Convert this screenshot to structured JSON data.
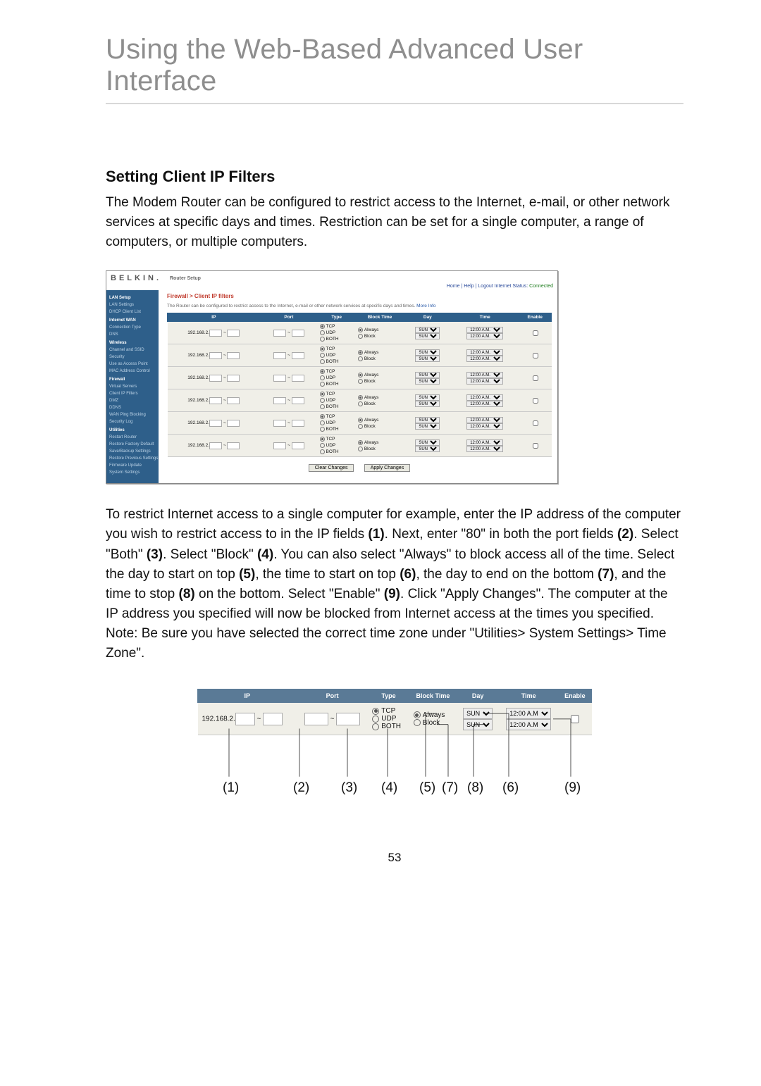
{
  "page_title": "Using the Web-Based Advanced User Interface",
  "section_title": "Setting Client IP Filters",
  "intro_paragraph": "The Modem Router can be configured to restrict access to the Internet, e-mail, or other network services at specific days and times. Restriction can be set for a single computer, a range of computers, or multiple computers.",
  "body_paragraph_parts": [
    "To restrict Internet access to a single computer for example, enter the IP address of the computer you wish to restrict access to in the IP fields ",
    "(1)",
    ". Next, enter \"80\" in both the port fields ",
    "(2)",
    ". Select \"Both\" ",
    "(3)",
    ". Select \"Block\" ",
    "(4)",
    ". You can also select \"Always\" to block access all of the time. Select the day to start on top ",
    "(5)",
    ", the time to start on top ",
    "(6)",
    ", the day to end on the bottom ",
    "(7)",
    ", and the time to stop ",
    "(8)",
    " on the bottom. Select \"Enable\" ",
    "(9)",
    ". Click \"Apply Changes\". The computer at the IP address you specified will now be blocked from Internet access at the times you specified. Note: Be sure you have selected the correct time zone under \"Utilities> System Settings> Time Zone\"."
  ],
  "page_number": "53",
  "router": {
    "logo": "BELKIN.",
    "subtitle": "Router Setup",
    "top_links": "Home | Help | Logout   Internet Status:",
    "status": "Connected",
    "breadcrumb": "Firewall > Client IP filters",
    "desc": "The Router can be configured to restrict access to the Internet, e-mail or other network services at specific days and times. ",
    "more": "More Info",
    "nav": [
      {
        "t": "LAN Setup",
        "h": true
      },
      {
        "t": "LAN Settings"
      },
      {
        "t": "DHCP Client List"
      },
      {
        "t": "Internet WAN",
        "h": true
      },
      {
        "t": "Connection Type"
      },
      {
        "t": "DNS"
      },
      {
        "t": "Wireless",
        "h": true
      },
      {
        "t": "Channel and SSID"
      },
      {
        "t": "Security"
      },
      {
        "t": "Use as Access Point"
      },
      {
        "t": "MAC Address Control"
      },
      {
        "t": "Firewall",
        "h": true
      },
      {
        "t": "Virtual Servers"
      },
      {
        "t": "Client IP Filters"
      },
      {
        "t": "DMZ"
      },
      {
        "t": "DDNS"
      },
      {
        "t": "WAN Ping Blocking"
      },
      {
        "t": "Security Log"
      },
      {
        "t": "Utilities",
        "h": true
      },
      {
        "t": "Restart Router"
      },
      {
        "t": "Restore Factory Default"
      },
      {
        "t": "Save/Backup Settings"
      },
      {
        "t": "Restore Previous Settings"
      },
      {
        "t": "Firmware Update"
      },
      {
        "t": "System Settings"
      }
    ],
    "columns": [
      "IP",
      "Port",
      "Type",
      "Block Time",
      "Day",
      "Time",
      "Enable"
    ],
    "ip_prefix": "192.168.2.",
    "type_options": [
      "TCP",
      "UDP",
      "BOTH"
    ],
    "block_options": [
      "Always",
      "Block"
    ],
    "day_value": "SUN",
    "time_value": "12:00 A.M.",
    "row_count": 6,
    "clear_btn": "Clear Changes",
    "apply_btn": "Apply Changes"
  },
  "detail": {
    "columns": [
      "IP",
      "Port",
      "Type",
      "Block Time",
      "Day",
      "Time",
      "Enable"
    ],
    "ip_prefix": "192.168.2.",
    "type_options": [
      "TCP",
      "UDP",
      "BOTH"
    ],
    "block_options": [
      "Always",
      "Block"
    ],
    "day_value": "SUN",
    "time_value": "12:00 A.M",
    "callouts": [
      "(1)",
      "(2)",
      "(3)",
      "(4)",
      "(5)",
      "(7)",
      "(8)",
      "(6)",
      "(9)"
    ]
  }
}
